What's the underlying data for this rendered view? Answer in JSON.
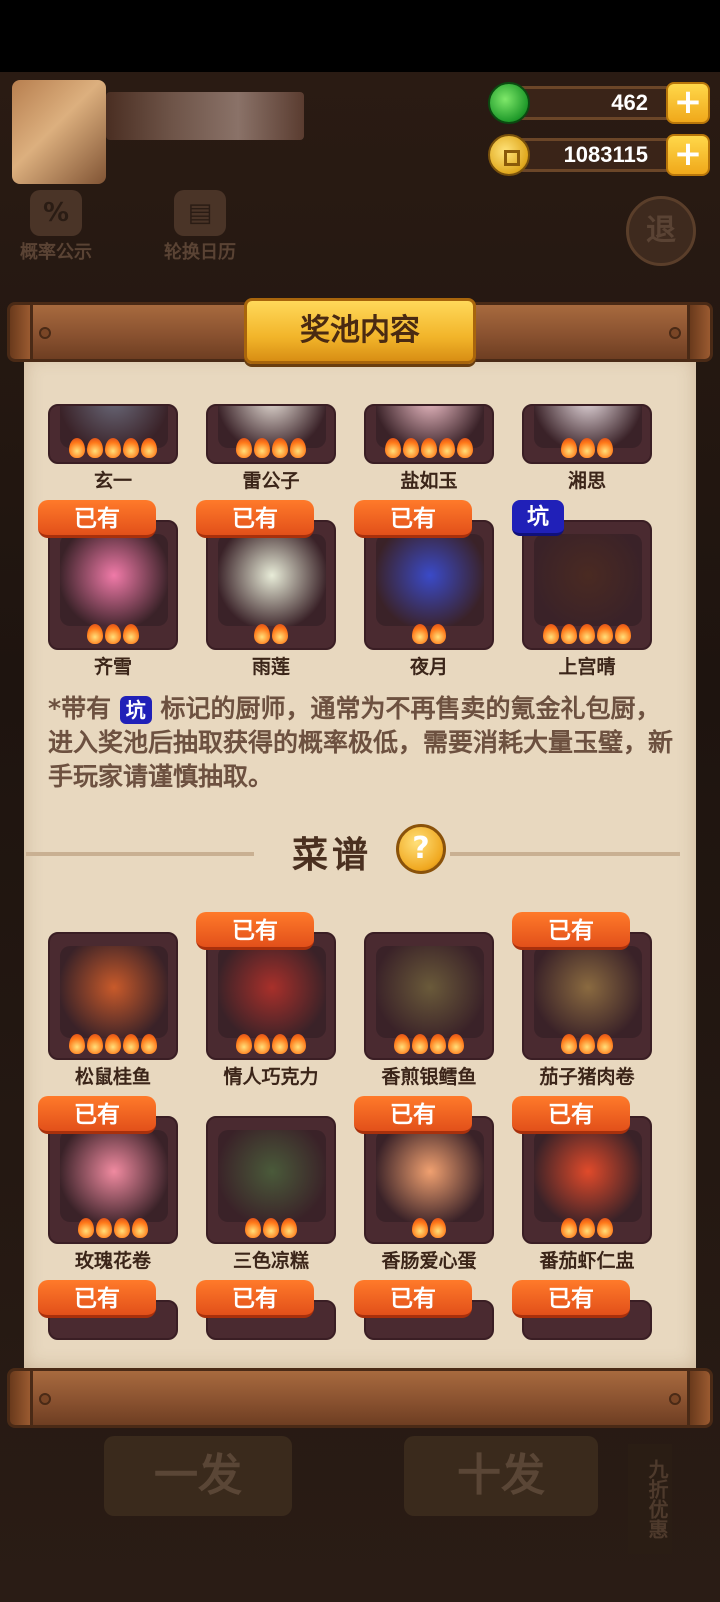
{
  "header": {
    "jade_amount": "462",
    "coin_amount": "1083115",
    "plus_label": "+",
    "probability_label": "概率公示",
    "calendar_label": "轮换日历",
    "exit_label": "退"
  },
  "panel": {
    "title": "奖池内容"
  },
  "tags": {
    "have": "已有",
    "keng": "坑"
  },
  "chefs": [
    {
      "name": "玄一",
      "stars": 5,
      "have": false,
      "keng": false
    },
    {
      "name": "雷公子",
      "stars": 4,
      "have": false,
      "keng": false
    },
    {
      "name": "盐如玉",
      "stars": 5,
      "have": false,
      "keng": false
    },
    {
      "name": "湘思",
      "stars": 3,
      "have": false,
      "keng": false
    },
    {
      "name": "齐雪",
      "stars": 3,
      "have": true,
      "keng": false
    },
    {
      "name": "雨莲",
      "stars": 2,
      "have": true,
      "keng": false
    },
    {
      "name": "夜月",
      "stars": 2,
      "have": true,
      "keng": false
    },
    {
      "name": "上宫晴",
      "stars": 5,
      "have": false,
      "keng": true
    }
  ],
  "notice": {
    "prefix": "*带有",
    "keng_label": "坑",
    "suffix": "标记的厨师，通常为不再售卖的氪金礼包厨，进入奖池后抽取获得的概率极低，需要消耗大量玉璧，新手玩家请谨慎抽取。"
  },
  "recipes_section": {
    "title": "菜谱",
    "help_label": "?"
  },
  "recipes": [
    {
      "name": "松鼠桂鱼",
      "stars": 5,
      "have": false
    },
    {
      "name": "情人巧克力",
      "stars": 4,
      "have": true
    },
    {
      "name": "香煎银鳕鱼",
      "stars": 4,
      "have": false
    },
    {
      "name": "茄子猪肉卷",
      "stars": 3,
      "have": true
    },
    {
      "name": "玫瑰花卷",
      "stars": 4,
      "have": true
    },
    {
      "name": "三色凉糕",
      "stars": 3,
      "have": false
    },
    {
      "name": "香肠爱心蛋",
      "stars": 2,
      "have": true
    },
    {
      "name": "番茄虾仁盅",
      "stars": 3,
      "have": true
    },
    {
      "name": "",
      "stars": 0,
      "have": true
    },
    {
      "name": "",
      "stars": 0,
      "have": true
    },
    {
      "name": "",
      "stars": 0,
      "have": true
    },
    {
      "name": "",
      "stars": 0,
      "have": true
    }
  ],
  "bottom": {
    "single_draw": "一发",
    "ten_draw": "十发",
    "side_label": "九折优惠"
  },
  "colors": {
    "have_tag": "#e2501a",
    "keng_tag": "#2020b8",
    "paper": "#e8d8bf",
    "card": "#4a2a30"
  }
}
